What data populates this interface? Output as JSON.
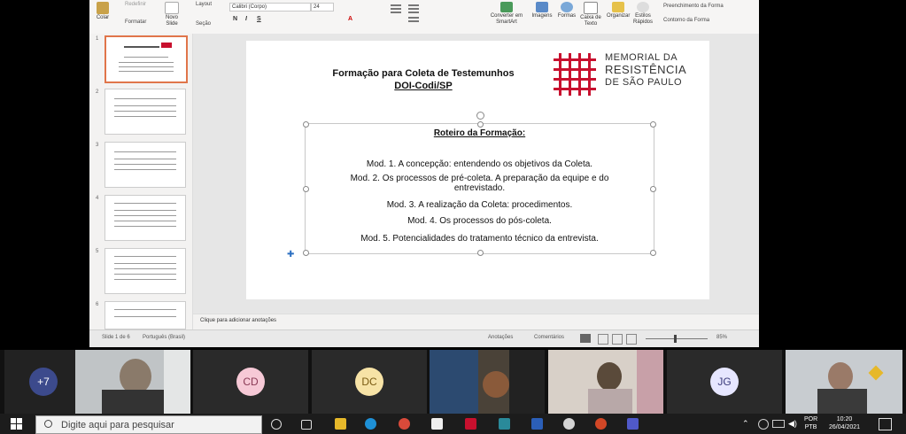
{
  "ribbon": {
    "paste_label": "Colar",
    "reset_label": "Redefinir",
    "format_label": "Formatar",
    "new_slide_label": "Novo Slide",
    "layout_label": "Layout",
    "section_label": "Seção",
    "font_name": "Calibri (Corpo)",
    "font_size": "24",
    "convert_smartart_label": "Converter em SmartArt",
    "images_label": "Imagens",
    "shapes_label": "Formas",
    "textbox_label": "Caixa de Texto",
    "arrange_label": "Organizar",
    "quick_styles_label": "Estilos Rápidos",
    "shape_fill_label": "Preenchimento da Forma",
    "shape_outline_label": "Contorno da Forma"
  },
  "thumbnails": [
    {
      "num": "1"
    },
    {
      "num": "2"
    },
    {
      "num": "3"
    },
    {
      "num": "4"
    },
    {
      "num": "5"
    },
    {
      "num": "6"
    }
  ],
  "slide": {
    "title_line1": "Formação para Coleta de Testemunhos",
    "title_line2": "DOI-Codi/SP",
    "logo_line1": "MEMORIAL DA",
    "logo_line2": "RESISTÊNCIA",
    "logo_line3": "DE SÃO PAULO",
    "logo_color": "#c8102e",
    "textbox_heading": "Roteiro da Formação:",
    "modules": [
      "Mod. 1. A concepção: entendendo os objetivos da Coleta.",
      "Mod. 2. Os processos de pré-coleta. A preparação da equipe e do",
      "entrevistado.",
      "Mod. 3. A realização da Coleta: procedimentos.",
      "Mod. 4. Os processos do pós-coleta.",
      "Mod. 5. Potencialidades do tratamento técnico da entrevista."
    ]
  },
  "notes_placeholder": "Clique para adicionar anotações",
  "status": {
    "slide_info": "Slide 1 de 6",
    "language": "Português (Brasil)",
    "notes_btn": "Anotações",
    "comments_btn": "Comentários",
    "zoom": "85%"
  },
  "participants": [
    {
      "label": "+7",
      "avatar_bg": "#3c4a8c",
      "text_color": "#ffffff"
    },
    {
      "label": "CD",
      "avatar_bg": "#f6c9d6",
      "text_color": "#8a3a55"
    },
    {
      "label": "DC",
      "avatar_bg": "#f7e3a6",
      "text_color": "#7a5b12"
    },
    {
      "label": "JG",
      "avatar_bg": "#e6e6ff",
      "text_color": "#3a3a7a"
    }
  ],
  "taskbar": {
    "search_placeholder": "Digite aqui para pesquisar",
    "lang": "POR",
    "layout": "PTB",
    "time": "10:20",
    "date": "26/04/2021"
  }
}
